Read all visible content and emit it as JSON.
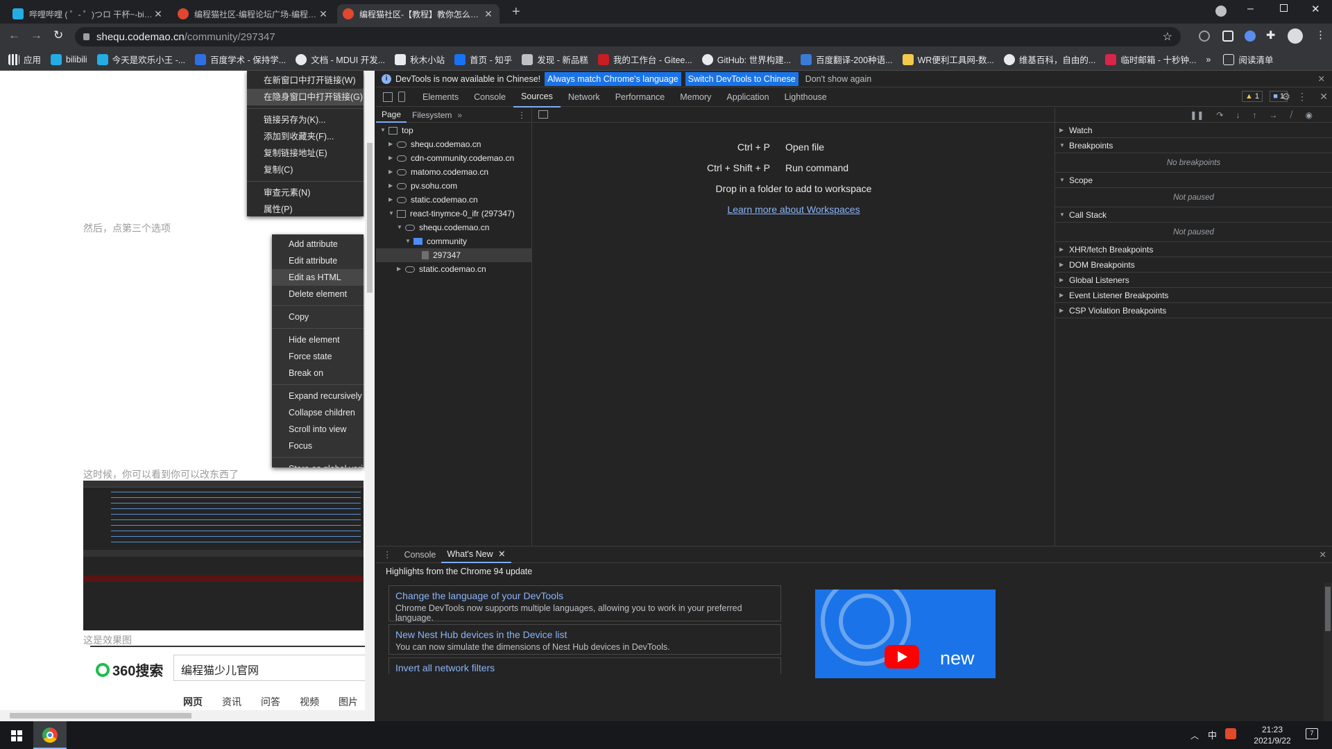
{
  "tabs": [
    {
      "title": "哔哩哔哩 ( ゜- ゜)つロ 干杯~-bilibili",
      "active": false
    },
    {
      "title": "编程猫社区-编程论坛广场-编程学习",
      "active": false
    },
    {
      "title": "编程猫社区-【教程】教你怎么用...",
      "active": true
    }
  ],
  "url": {
    "host": "shequ.codemao.cn",
    "path": "/community/297347"
  },
  "bookmarks": [
    "应用",
    "bilibili",
    "今天是欢乐小王 -...",
    "百度学术 - 保持学...",
    "文档 - MDUI 开发...",
    "秋木小站",
    "首页 - 知乎",
    "发现 - 新品糕",
    "我的工作台 - Gitee...",
    "GitHub: 世界构建...",
    "百度翻译-200种语...",
    "WR便利工具网-数...",
    "维基百科，自由的...",
    "临时邮箱 - 十秒钟...",
    "»",
    "阅读清单"
  ],
  "page": {
    "caption1": "然后，点第三个选项",
    "caption2": "这时候，你可以看到你可以改东西了",
    "caption3": "这是效果图",
    "search_logo": "360搜索",
    "search_value": "编程猫少儿官网",
    "search_tabs": [
      "网页",
      "资讯",
      "问答",
      "视频",
      "图片"
    ]
  },
  "browser_menu": [
    "在新窗口中打开链接(W)",
    "在隐身窗口中打开链接(G)",
    "链接另存为(K)...",
    "添加到收藏夹(F)...",
    "复制链接地址(E)",
    "复制(C)",
    "审查元素(N)",
    "属性(P)"
  ],
  "element_menu": [
    "Add attribute",
    "Edit attribute",
    "Edit as HTML",
    "Delete element",
    "Copy",
    "Hide element",
    "Force state",
    "Break on",
    "Expand recursively",
    "Collapse children",
    "Scroll into view",
    "Focus",
    "Store as global variable"
  ],
  "devtools": {
    "infobar": {
      "text": "DevTools is now available in Chinese!",
      "btn1": "Always match Chrome's language",
      "btn2": "Switch DevTools to Chinese",
      "btn3": "Don't show again"
    },
    "tabs": [
      "Elements",
      "Console",
      "Sources",
      "Network",
      "Performance",
      "Memory",
      "Application",
      "Lighthouse"
    ],
    "warn_count": "1",
    "msg_count": "1",
    "nav_tabs": [
      "Page",
      "Filesystem"
    ],
    "tree": [
      {
        "label": "top",
        "depth": 0,
        "kind": "frame",
        "open": true
      },
      {
        "label": "shequ.codemao.cn",
        "depth": 1,
        "kind": "cloud"
      },
      {
        "label": "cdn-community.codemao.cn",
        "depth": 1,
        "kind": "cloud"
      },
      {
        "label": "matomo.codemao.cn",
        "depth": 1,
        "kind": "cloud"
      },
      {
        "label": "pv.sohu.com",
        "depth": 1,
        "kind": "cloud"
      },
      {
        "label": "static.codemao.cn",
        "depth": 1,
        "kind": "cloud"
      },
      {
        "label": "react-tinymce-0_ifr (297347)",
        "depth": 1,
        "kind": "frame",
        "open": true
      },
      {
        "label": "shequ.codemao.cn",
        "depth": 2,
        "kind": "cloud",
        "open": true
      },
      {
        "label": "community",
        "depth": 3,
        "kind": "folder",
        "open": true
      },
      {
        "label": "297347",
        "depth": 4,
        "kind": "file",
        "selected": true
      },
      {
        "label": "static.codemao.cn",
        "depth": 2,
        "kind": "cloud"
      }
    ],
    "shortcuts": [
      {
        "keys": "Ctrl + P",
        "action": "Open file"
      },
      {
        "keys": "Ctrl + Shift + P",
        "action": "Run command"
      }
    ],
    "drop_text": "Drop in a folder to add to workspace",
    "learn_link": "Learn more about Workspaces",
    "debugger": [
      {
        "title": "Watch",
        "open": false
      },
      {
        "title": "Breakpoints",
        "open": true,
        "body": "No breakpoints"
      },
      {
        "title": "Scope",
        "open": true,
        "body": "Not paused"
      },
      {
        "title": "Call Stack",
        "open": true,
        "body": "Not paused"
      },
      {
        "title": "XHR/fetch Breakpoints",
        "open": false
      },
      {
        "title": "DOM Breakpoints",
        "open": false
      },
      {
        "title": "Global Listeners",
        "open": false
      },
      {
        "title": "Event Listener Breakpoints",
        "open": false
      },
      {
        "title": "CSP Violation Breakpoints",
        "open": false
      }
    ],
    "drawer": {
      "tabs": [
        "Console",
        "What's New"
      ],
      "highlight": "Highlights from the Chrome 94 update",
      "cards": [
        {
          "title": "Change the language of your DevTools",
          "desc": "Chrome DevTools now supports multiple languages, allowing you to work in your preferred language."
        },
        {
          "title": "New Nest Hub devices in the Device list",
          "desc": "You can now simulate the dimensions of Nest Hub devices in DevTools."
        },
        {
          "title": "Invert all network filters",
          "desc": ""
        }
      ],
      "video_text": "new"
    }
  },
  "taskbar": {
    "ime": "中",
    "time": "21:23",
    "date": "2021/9/22",
    "notif_count": "7"
  }
}
